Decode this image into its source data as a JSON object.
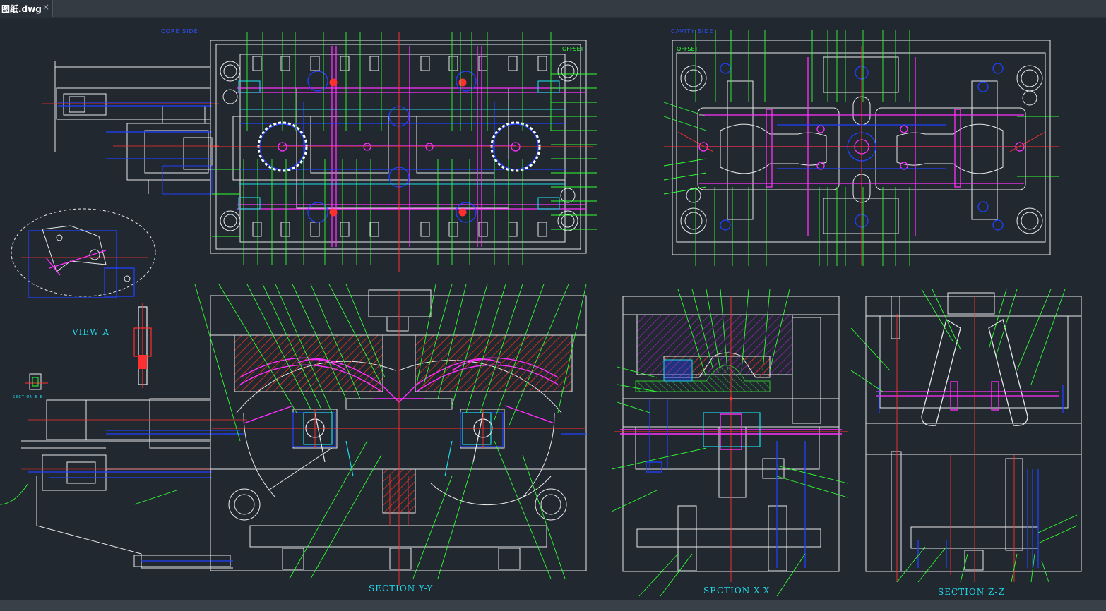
{
  "tab": {
    "title": "图纸.dwg",
    "close": "×"
  },
  "labels": {
    "core_side": "CORE SIDE",
    "cavity_side": "CAVITY SIDE",
    "offset_core": "OFFSET",
    "offset_cavity": "OFFSET",
    "view_a": "VIEW A",
    "section_yy": "SECTION Y-Y",
    "section_xx": "SECTION X-X",
    "section_zz": "SECTION Z-Z",
    "section_bb": "SECTION B-B"
  },
  "colors": {
    "background": "#212830",
    "white": "#e8e8e8",
    "green": "#30ff30",
    "magenta": "#ff30ff",
    "blue": "#2040ff",
    "cyan": "#20d8e8",
    "red": "#ff3030",
    "yellow": "#e8e020",
    "hatch": "#c03020"
  }
}
